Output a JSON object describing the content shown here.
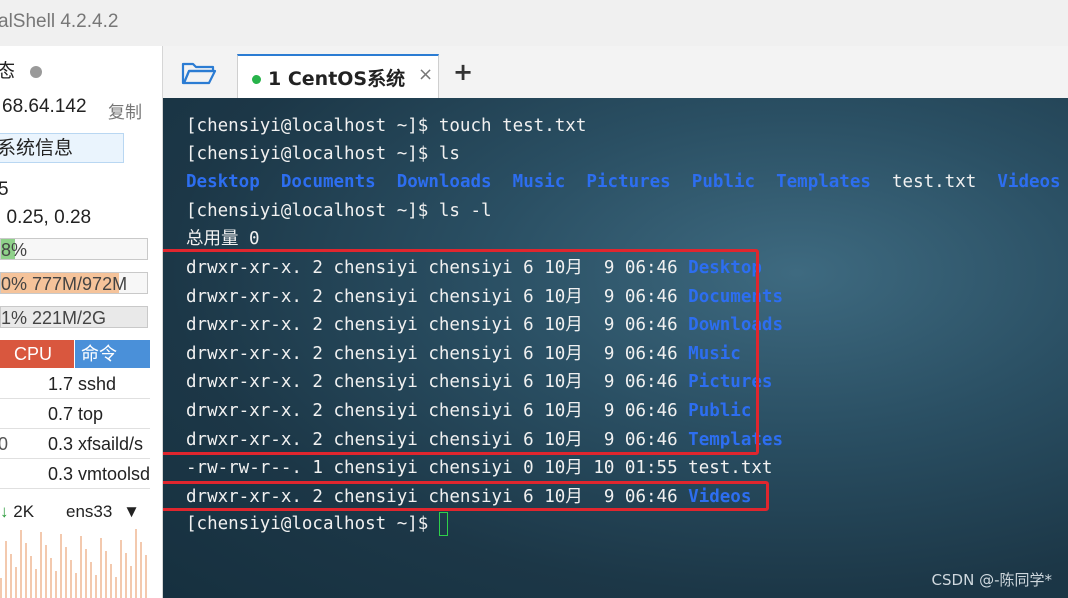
{
  "window": {
    "title": "alShell 4.2.4.2"
  },
  "side": {
    "status_label": "态",
    "ip": "68.64.142",
    "copy_label": "复制",
    "sysinfo_label": "系统信息",
    "uptime_fragment": "5",
    "load_avg": ", 0.25, 0.28",
    "cpu_meter": {
      "text": "8%",
      "color": "#8fd18a"
    },
    "mem_meter": {
      "text": "0%  777M/972M",
      "color": "#f5c39a"
    },
    "swap_meter": {
      "text": "1%      221M/2G",
      "color": "#e9e9e9"
    },
    "process_headers": {
      "cpu": "CPU",
      "cmd": "命令"
    },
    "processes": [
      {
        "pid": "",
        "cpu": "1.7",
        "cmd": "sshd"
      },
      {
        "pid": "",
        "cpu": "0.7",
        "cmd": "top"
      },
      {
        "pid": "0",
        "cpu": "0.3",
        "cmd": "xfsaild/s"
      },
      {
        "pid": "",
        "cpu": "0.3",
        "cmd": "vmtoolsd"
      }
    ],
    "net": {
      "down_icon": "arrow-down-icon",
      "down_value": "2K",
      "interface": "ens33"
    }
  },
  "tabs": [
    {
      "label": "1 CentOS系统",
      "status_color": "#27b34a",
      "close": "×"
    }
  ],
  "tab_add": "+",
  "terminal": {
    "prompt": "[chensiyi@localhost ~]$",
    "cmd1": " touch test.txt",
    "cmd2": " ls",
    "ls_items": [
      "Desktop",
      "Documents",
      "Downloads",
      "Music",
      "Pictures",
      "Public",
      "Templates",
      "test.txt",
      "Videos"
    ],
    "cmd3": " ls -l",
    "total": "总用量 0",
    "listing": [
      {
        "meta": "drwxr-xr-x. 2 chensiyi chensiyi 6 10月  9 06:46 ",
        "name": "Desktop",
        "is_dir": true
      },
      {
        "meta": "drwxr-xr-x. 2 chensiyi chensiyi 6 10月  9 06:46 ",
        "name": "Documents",
        "is_dir": true
      },
      {
        "meta": "drwxr-xr-x. 2 chensiyi chensiyi 6 10月  9 06:46 ",
        "name": "Downloads",
        "is_dir": true
      },
      {
        "meta": "drwxr-xr-x. 2 chensiyi chensiyi 6 10月  9 06:46 ",
        "name": "Music",
        "is_dir": true
      },
      {
        "meta": "drwxr-xr-x. 2 chensiyi chensiyi 6 10月  9 06:46 ",
        "name": "Pictures",
        "is_dir": true
      },
      {
        "meta": "drwxr-xr-x. 2 chensiyi chensiyi 6 10月  9 06:46 ",
        "name": "Public",
        "is_dir": true
      },
      {
        "meta": "drwxr-xr-x. 2 chensiyi chensiyi 6 10月  9 06:46 ",
        "name": "Templates",
        "is_dir": true
      },
      {
        "meta": "-rw-rw-r--. 1 chensiyi chensiyi 0 10月 10 01:55 ",
        "name": "test.txt",
        "is_dir": false
      },
      {
        "meta": "drwxr-xr-x. 2 chensiyi chensiyi 6 10月  9 06:46 ",
        "name": "Videos",
        "is_dir": true
      }
    ],
    "dir_color": "#2d6ef0",
    "highlight_color": "#e0262e"
  },
  "watermark": "CSDN @-陈同学*"
}
